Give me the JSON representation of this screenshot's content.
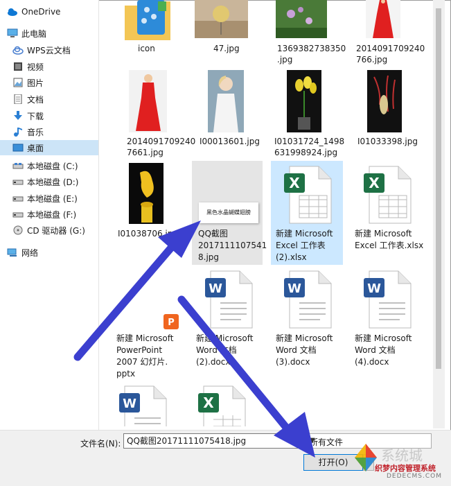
{
  "sidebar": {
    "items": [
      {
        "label": "OneDrive",
        "icon": "cloud-icon"
      },
      {
        "label": "此电脑",
        "icon": "computer-icon"
      },
      {
        "label": "WPS云文档",
        "icon": "cloud-icon"
      },
      {
        "label": "视频",
        "icon": "video-icon"
      },
      {
        "label": "图片",
        "icon": "picture-icon"
      },
      {
        "label": "文档",
        "icon": "document-icon"
      },
      {
        "label": "下载",
        "icon": "download-icon"
      },
      {
        "label": "音乐",
        "icon": "music-icon"
      },
      {
        "label": "桌面",
        "icon": "desktop-icon",
        "selected": true
      },
      {
        "label": "本地磁盘 (C:)",
        "icon": "drive-icon"
      },
      {
        "label": "本地磁盘 (D:)",
        "icon": "drive-icon"
      },
      {
        "label": "本地磁盘 (E:)",
        "icon": "drive-icon"
      },
      {
        "label": "本地磁盘 (F:)",
        "icon": "drive-icon"
      },
      {
        "label": "CD 驱动器 (G:)",
        "icon": "cd-drive-icon"
      },
      {
        "label": "网络",
        "icon": "network-icon"
      }
    ]
  },
  "files": {
    "items": [
      {
        "name": "icon",
        "kind": "folder"
      },
      {
        "name": "47.jpg",
        "kind": "image"
      },
      {
        "name": "1369382738350.jpg",
        "kind": "image"
      },
      {
        "name": "20140917092407 66.jpg",
        "kind": "image"
      },
      {
        "name": "20140917092407661.jpg",
        "kind": "image"
      },
      {
        "name": "I00013601.jpg",
        "kind": "image"
      },
      {
        "name": "I01031724_1498631998924.jpg",
        "kind": "image"
      },
      {
        "name": "I01033398.jpg",
        "kind": "image"
      },
      {
        "name": "I01038706.jpg",
        "kind": "image"
      },
      {
        "name": "QQ截图20171111075418.jpg",
        "kind": "image",
        "thumb_text": "黑色水晶蝴蝶翅膀",
        "visible_name": "QQ截图 20171110 7541 8.jpg"
      },
      {
        "name": "新建 Microsoft Excel 工作表 (2).xlsx",
        "kind": "excel"
      },
      {
        "name": "新建 Microsoft Excel 工作表.xlsx",
        "kind": "excel"
      },
      {
        "name": "新建 Microsoft PowerPoint 2007 幻灯片.pptx",
        "kind": "ppt"
      },
      {
        "name": "新建 Microsoft Word 文档 (2).docx",
        "kind": "word"
      },
      {
        "name": "新建 Microsoft Word 文档 (3).docx",
        "kind": "word"
      },
      {
        "name": "新建 Microsoft Word 文档 (4).docx",
        "kind": "word"
      }
    ],
    "labels": {
      "f0": "icon",
      "f1": "47.jpg",
      "f2a": "1369382738350",
      "f2b": ".jpg",
      "f3a": "2014091709240",
      "f3b": "766.jpg",
      "f4a": "2014091709240",
      "f4b": "7661.jpg",
      "f5": "I00013601.jpg",
      "f6a": "I01031724_1498",
      "f6b": "631998924.jpg",
      "f7": "I01033398.jpg",
      "f8": "I01038706.jpg",
      "f9a": "QQ截图",
      "f9b": "2017111107541",
      "f9c": "8.jpg",
      "f9thumb": "黑色水晶蝴蝶翅膀",
      "f10a": "新建 Microsoft",
      "f10b": "Excel 工作表",
      "f10c": "(2).xlsx",
      "f11a": "新建 Microsoft",
      "f11b": "Excel 工作表.xlsx",
      "f12a": "新建 Microsoft",
      "f12b": "PowerPoint",
      "f12c": "2007 幻灯片.",
      "f12d": "pptx",
      "f13a": "新建 Microsoft",
      "f13b": "Word 文档",
      "f13c": "(2).docx",
      "f14a": "新建 Microsoft",
      "f14b": "Word 文档",
      "f14c": "(3).docx",
      "f15a": "新建 Microsoft",
      "f15b": "Word 文档",
      "f15c": "(4).docx"
    }
  },
  "bottom": {
    "filename_label": "文件名(N):",
    "filename_value": "QQ截图20171111075418.jpg",
    "filetype_value": "所有文件",
    "open_label": "打开(O)"
  },
  "watermark": {
    "text": "织梦内容管理系统",
    "url": "DEDECMS.COM"
  },
  "colors": {
    "selection": "#cce8ff",
    "nav_selected": "#cce4f7",
    "arrow": "#3b3fcf",
    "excel": "#1e7145",
    "word": "#2b579a",
    "ppt": "#f0651f"
  }
}
